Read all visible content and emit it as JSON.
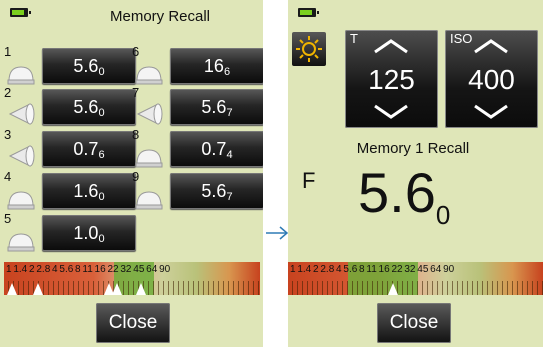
{
  "left_panel": {
    "title": "Memory Recall",
    "slots": [
      {
        "num": "1",
        "value": "5.6",
        "sub": "0",
        "icon": "dome-icon"
      },
      {
        "num": "2",
        "value": "5.6",
        "sub": "0",
        "icon": "flat-disc-icon"
      },
      {
        "num": "3",
        "value": "0.7",
        "sub": "6",
        "icon": "flat-disc-icon"
      },
      {
        "num": "4",
        "value": "1.6",
        "sub": "0",
        "icon": "dome-icon"
      },
      {
        "num": "5",
        "value": "1.0",
        "sub": "0",
        "icon": "dome-icon"
      },
      {
        "num": "6",
        "value": "16",
        "sub": "6",
        "icon": "dome-icon"
      },
      {
        "num": "7",
        "value": "5.6",
        "sub": "7",
        "icon": "flat-disc-icon"
      },
      {
        "num": "8",
        "value": "0.7",
        "sub": "4",
        "icon": "dome-icon"
      },
      {
        "num": "9",
        "value": "5.6",
        "sub": "7",
        "icon": "dome-icon"
      }
    ],
    "scale_labels": "1 1.4 2 2.8 4 5.6 8 11 16 22 32 45 64 90",
    "close_label": "Close"
  },
  "right_panel": {
    "t_label": "T",
    "t_value": "125",
    "iso_label": "ISO",
    "iso_value": "400",
    "recall_text": "Memory 1 Recall",
    "f_label": "F",
    "f_value": "5.6",
    "f_sub": "0",
    "scale_labels": "1 1.4 2 2.8 4 5.6 8 11 16 22 32 45 64 90",
    "close_label": "Close"
  },
  "icons": [
    "battery-icon",
    "sun-icon",
    "arrow-up-icon",
    "arrow-down-icon",
    "right-arrow-icon",
    "dome-icon",
    "flat-disc-icon"
  ],
  "colors": {
    "panel_bg": "#dfe6b8",
    "button_dark": "#111111",
    "arrow": "#2f7bb5",
    "battery_green": "#7bd01e",
    "scale_red": "#c8431f"
  }
}
